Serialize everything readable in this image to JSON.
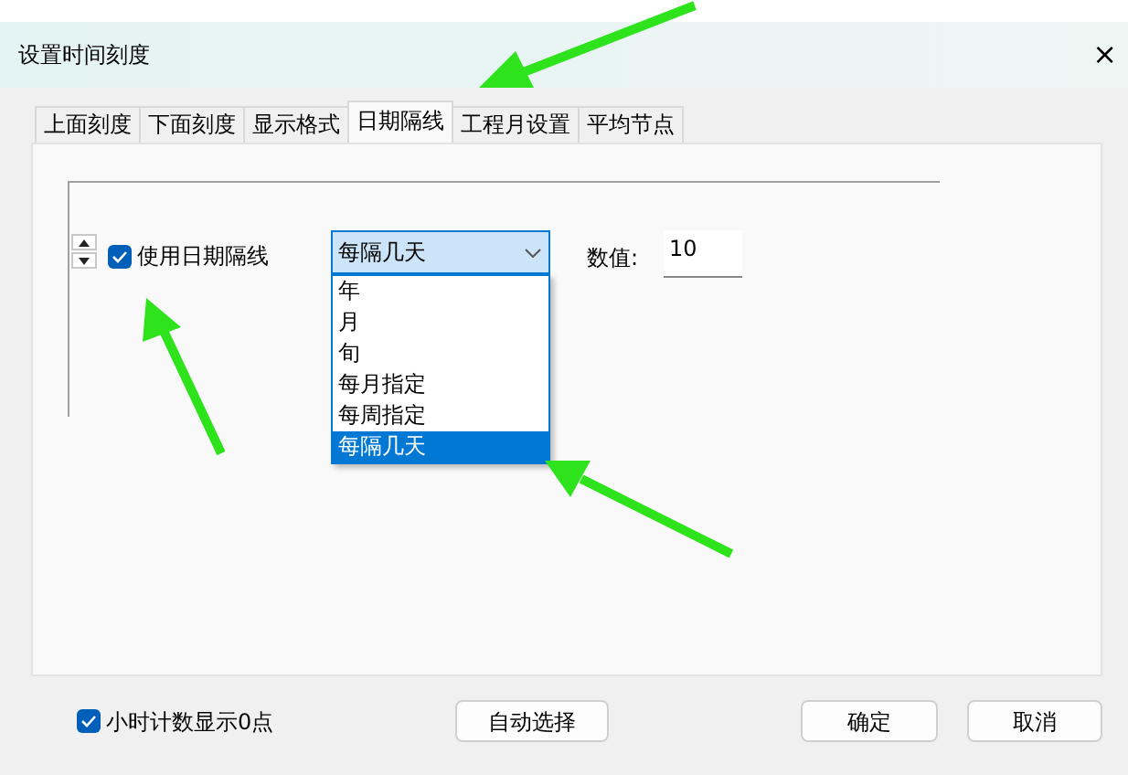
{
  "window": {
    "title": "设置时间刻度",
    "close": "×"
  },
  "tabs": [
    {
      "label": "上面刻度",
      "selected": false
    },
    {
      "label": "下面刻度",
      "selected": false
    },
    {
      "label": "显示格式",
      "selected": false
    },
    {
      "label": "日期隔线",
      "selected": true
    },
    {
      "label": "工程月设置",
      "selected": false
    },
    {
      "label": "平均节点",
      "selected": false
    }
  ],
  "date_lines": {
    "enabled": {
      "label": "使用日期隔线",
      "checked": true
    },
    "interval_type": {
      "value": "每隔几天",
      "expanded": true,
      "options": [
        {
          "label": "年",
          "selected": false
        },
        {
          "label": "月",
          "selected": false
        },
        {
          "label": "旬",
          "selected": false
        },
        {
          "label": "每月指定",
          "selected": false
        },
        {
          "label": "每周指定",
          "selected": false
        },
        {
          "label": "每隔几天",
          "selected": true
        }
      ]
    },
    "value_label": "数值:",
    "value": "10"
  },
  "hour_zero": {
    "label": "小时计数显示0点",
    "checked": true
  },
  "buttons": [
    "自动选择",
    "确定",
    "取消"
  ]
}
